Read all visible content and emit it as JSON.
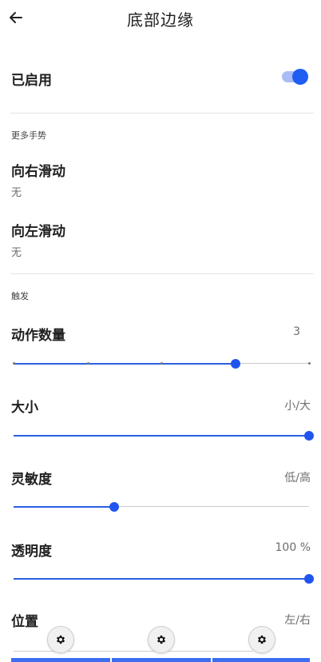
{
  "header": {
    "title": "底部边缘"
  },
  "enabled": {
    "label": "已启用",
    "on": true
  },
  "more_gestures": {
    "header": "更多手势",
    "swipe_right": {
      "title": "向右滑动",
      "value": "无"
    },
    "swipe_left": {
      "title": "向左滑动",
      "value": "无"
    }
  },
  "trigger": {
    "header": "触发",
    "action_count": {
      "label": "动作数量",
      "value": "3",
      "level": 0.75,
      "steps": 4
    },
    "size": {
      "label": "大小",
      "value": "小/大",
      "level": 1.0
    },
    "sensitivity": {
      "label": "灵敏度",
      "value": "低/高",
      "level": 0.34
    },
    "opacity": {
      "label": "透明度",
      "value": "100 %",
      "level": 1.0
    },
    "position": {
      "label": "位置",
      "value": "左/右"
    }
  },
  "colors": {
    "accent": "#1f5ef0",
    "accent_light": "#aabcf6"
  },
  "icons": {
    "back": "arrow-left-icon",
    "gear": "gear-icon"
  }
}
